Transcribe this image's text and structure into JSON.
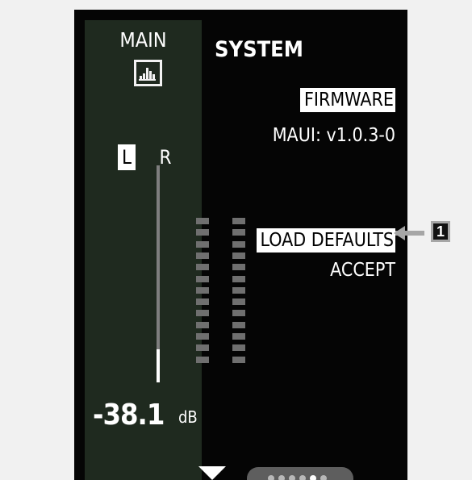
{
  "left_panel": {
    "title": "MAIN",
    "icon": "equalizer-bars-icon",
    "channels": {
      "left": "L",
      "right": "R"
    },
    "meter": {
      "segment_count": 13,
      "value": "-38.1",
      "unit": "dB"
    },
    "nav_icon": "down-arrow-icon"
  },
  "system": {
    "title": "SYSTEM",
    "firmware_label": "FIRMWARE",
    "firmware_value": "MAUI: v1.0.3-0",
    "load_defaults_label": "LOAD DEFAULTS",
    "accept_label": "ACCEPT"
  },
  "pager": {
    "total_dots": 6,
    "active_dot": 5
  },
  "callout": {
    "number": "1"
  },
  "colors": {
    "background": "#f1f1f1",
    "screen": "#050505",
    "panel": "#1f2a1f",
    "meter_segment": "#6f6f6f",
    "callout": "#a6a6a6"
  }
}
